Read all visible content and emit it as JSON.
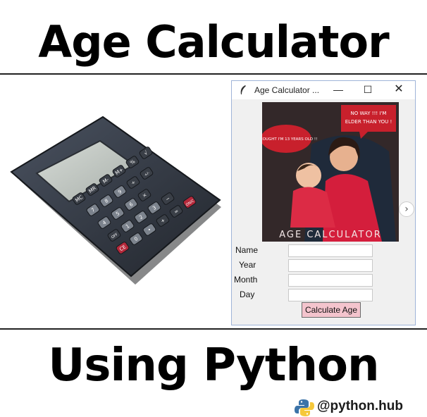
{
  "headline_top": "Age Calculator",
  "headline_bottom": "Using Python",
  "calculator_keys": [
    "MC",
    "MR",
    "M-",
    "M+",
    "%",
    "√",
    "7",
    "8",
    "9",
    "÷",
    "+/-",
    "4",
    "5",
    "6",
    "×",
    "OFF",
    "1",
    "2",
    "3",
    "−",
    "CE",
    "0",
    "•",
    "+",
    "=",
    "ON/C"
  ],
  "tk_window": {
    "title": "Age Calculator ...",
    "minimize": "—",
    "maximize": "☐",
    "close": "✕",
    "banner": {
      "caption": "AGE CALCULATOR",
      "bubble_left": "I THOUGHT I'M 13 YEARS OLD !!",
      "bubble_right": "NO WAY !!! I'M ELDER THAN YOU !"
    },
    "fields": {
      "name_label": "Name",
      "year_label": "Year",
      "month_label": "Month",
      "day_label": "Day",
      "name_value": "",
      "year_value": "",
      "month_value": "",
      "day_value": ""
    },
    "button_label": "Calculate Age"
  },
  "side_arrow": "›",
  "watermark": {
    "handle": "@python.hub",
    "icon": "python-logo"
  },
  "colors": {
    "button": "#f4c4cd",
    "banner_red": "#c8202c"
  }
}
